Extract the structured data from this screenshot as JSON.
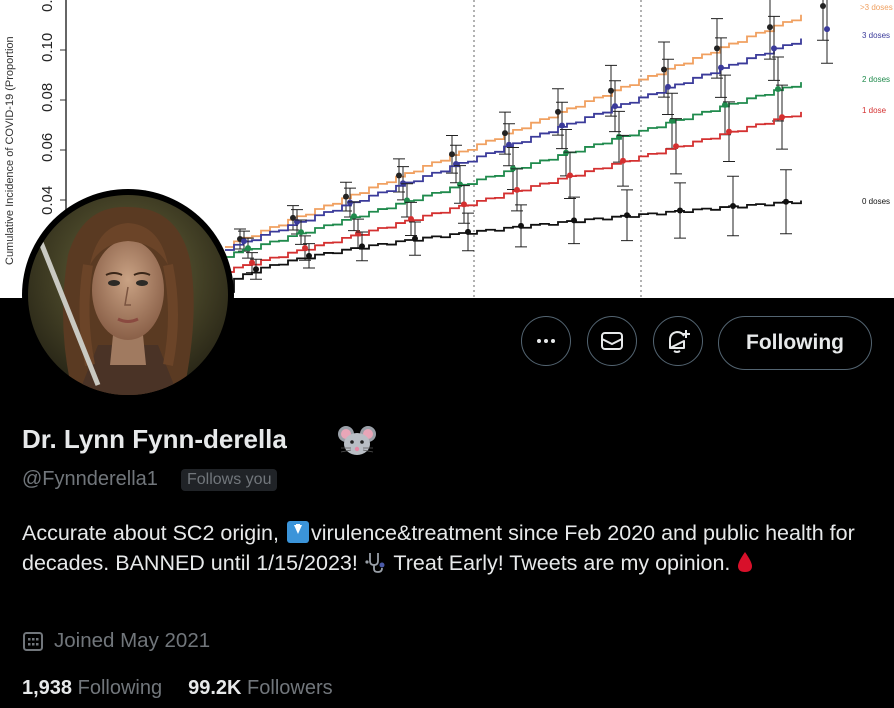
{
  "banner": {
    "ylabel": "Cumulative Incidence of COVID-19 (Proportion",
    "yticks": [
      "0.04",
      "0.06",
      "0.08",
      "0.10",
      "0."
    ],
    "series_labels": {
      "top": ">3 doses",
      "three": "3 doses",
      "two": "2 doses",
      "one": "1 dose",
      "zero": "0 doses"
    },
    "colors": {
      "orange": "#f0a060",
      "navy": "#3a3a9a",
      "green": "#1f8a4c",
      "red": "#d43030",
      "black": "#111111"
    }
  },
  "profile": {
    "display_name": "Dr. Lynn Fynn-derella",
    "name_emoji": "mouse-face-icon",
    "handle": "@Fynnderella1",
    "follows_you": "Follows you",
    "bio": {
      "part1": "Accurate about SC2 origin, ",
      "part2": "virulence&treatment since Feb 2020 and public health for decades. BANNED until 1/15/2023! ",
      "part3": " Treat Early! Tweets are my opinion. "
    },
    "joined": "Joined May 2021",
    "following_count": "1,938",
    "following_label": "Following",
    "followers_count": "99.2K",
    "followers_label": "Followers"
  },
  "actions": {
    "more": "more-icon",
    "message": "envelope-icon",
    "notify": "bell-plus-icon",
    "follow_label": "Following"
  }
}
